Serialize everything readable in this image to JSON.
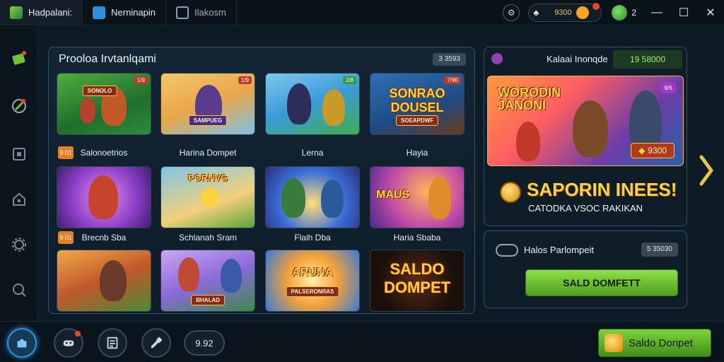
{
  "titlebar": {
    "tabs": [
      {
        "label": "Hadpalani:"
      },
      {
        "label": "Nerninapin"
      },
      {
        "label": "Ilakosm"
      }
    ],
    "coins": "9300",
    "gems": "2"
  },
  "library": {
    "title": "Prooloa Irvtanlqami",
    "badge": "3 3593",
    "tiles": [
      {
        "caption": "Salonoetrios",
        "banner": "SONOLO",
        "tag": "1/9",
        "badge": "9 01"
      },
      {
        "caption": "Harina Dompet",
        "banner": "SAMPUEG",
        "tag": "1/9"
      },
      {
        "caption": "Lerna",
        "tag": "2/8"
      },
      {
        "caption": "Hayia",
        "big": "SONRAO DOUSEL",
        "banner": "SOEAPDWF",
        "tag": "7/90"
      },
      {
        "caption": "Brecnb Sba",
        "badge": "9 01"
      },
      {
        "caption": "Schlanah Sram",
        "big": "PORNVG"
      },
      {
        "caption": "Flaih Dba"
      },
      {
        "caption": "Haria Sbaba",
        "big": "MAUS"
      },
      {
        "caption": ""
      },
      {
        "caption": "",
        "banner": "BHALAD"
      },
      {
        "caption": "",
        "big": "ARUNA",
        "banner": "PALSERONRAS"
      },
      {
        "caption": "",
        "big": "SALDO DOMPET"
      }
    ]
  },
  "promo": {
    "label": "Kalaai Inonqde",
    "balance": "19 58000",
    "art_title": "WORODIN JANONI",
    "price": "9300",
    "chip": "9/6",
    "headline": "SAPORIN INEES!",
    "sub": "CATODKA VSOC RAKIKAN"
  },
  "wallet": {
    "label": "Halos Parlompeit",
    "value": "5 35030",
    "button": "SALD DOMFETT"
  },
  "bottom": {
    "pill": "9.92",
    "cta": "Saldo Donpet"
  },
  "colors": {
    "accent_green": "#6fc13a",
    "accent_blue": "#2f8fd8",
    "gold": "#ffd23f"
  }
}
